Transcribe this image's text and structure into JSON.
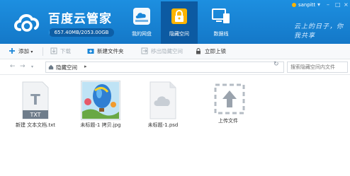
{
  "app": {
    "title": "百度云管家",
    "quota": "657.40MB/2053.00GB",
    "quota_fraction": 0.0003,
    "slogan": "云上的日子，你我共享"
  },
  "user": {
    "name": "sanpitt"
  },
  "nav": [
    {
      "label": "我的网盘",
      "icon": "cloud-drive-icon",
      "active": false
    },
    {
      "label": "隐藏空间",
      "icon": "lock-icon",
      "active": true
    },
    {
      "label": "数据线",
      "icon": "monitor-icon",
      "active": false
    }
  ],
  "toolbar": {
    "add": "添加",
    "download": "下载",
    "new_folder": "新建文件夹",
    "move_out": "移出隐藏空间",
    "lock_now": "立即上锁"
  },
  "address": {
    "path": "隐藏空间",
    "search_placeholder": "搜索隐藏空间内文件"
  },
  "files": [
    {
      "name": "新建 文本文档.txt",
      "type": "txt",
      "badge": "TXT"
    },
    {
      "name": "未标题-1 拷贝.jpg",
      "type": "image"
    },
    {
      "name": "未标题-1.psd",
      "type": "psd"
    },
    {
      "name": "上传文件",
      "type": "upload"
    }
  ],
  "colors": {
    "header": "#1a86d8",
    "active_tab": "#0c5aa2",
    "lock_yellow": "#ffb400"
  }
}
